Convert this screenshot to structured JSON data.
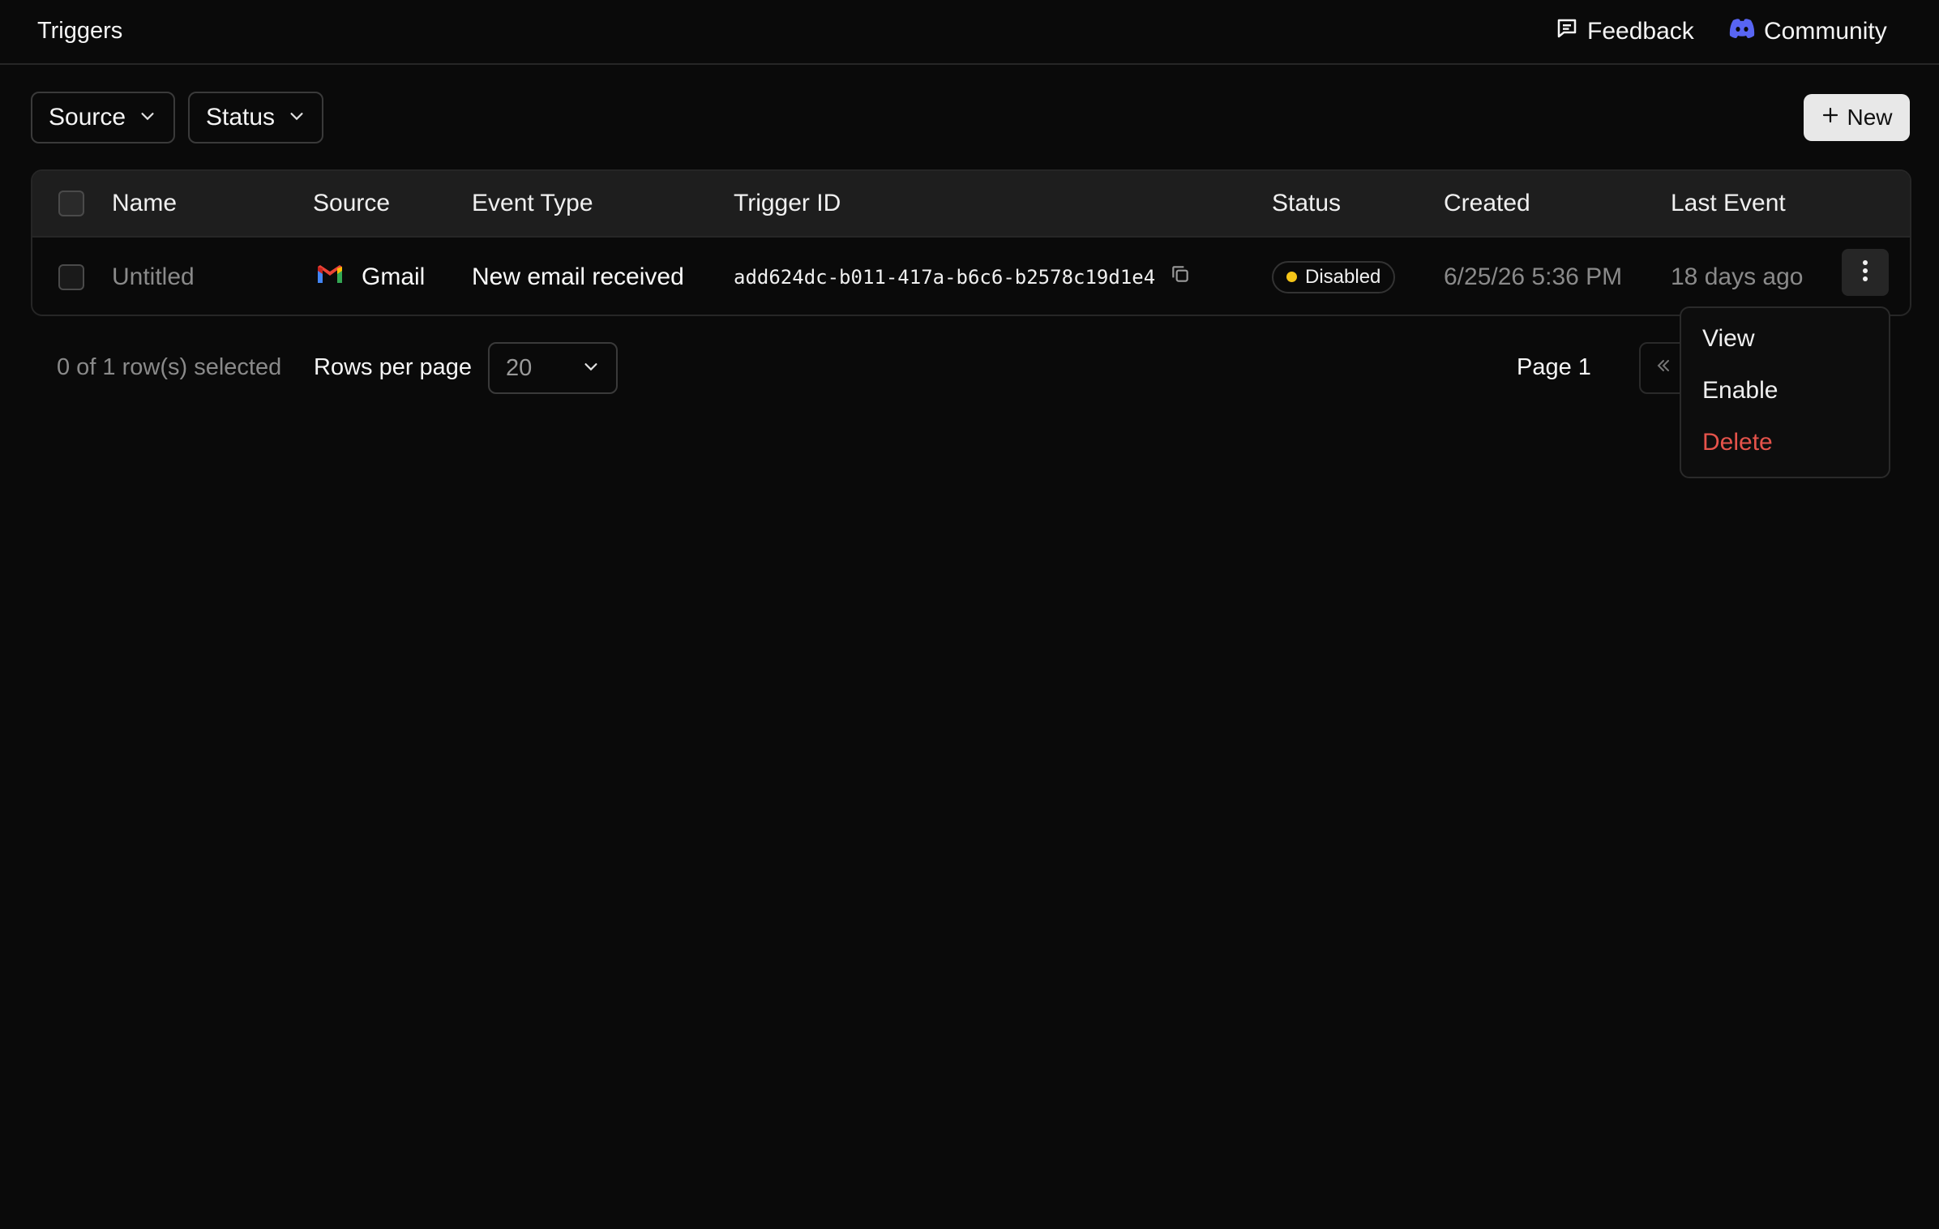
{
  "header": {
    "title": "Triggers",
    "feedback_label": "Feedback",
    "community_label": "Community"
  },
  "toolbar": {
    "filters": [
      {
        "label": "Source"
      },
      {
        "label": "Status"
      }
    ],
    "new_label": "New"
  },
  "table": {
    "columns": [
      "Name",
      "Source",
      "Event Type",
      "Trigger ID",
      "Status",
      "Created",
      "Last Event"
    ],
    "rows": [
      {
        "name": "Untitled",
        "source": "Gmail",
        "event_type": "New email received",
        "trigger_id": "add624dc-b011-417a-b6c6-b2578c19d1e4",
        "status": "Disabled",
        "created": "6/25/26 5:36 PM",
        "last_event": "18 days ago"
      }
    ]
  },
  "footer": {
    "selection_text": "0 of 1 row(s) selected",
    "rows_per_page_label": "Rows per page",
    "rows_per_page_value": "20",
    "page_text": "Page 1"
  },
  "row_menu": {
    "items": [
      {
        "label": "View"
      },
      {
        "label": "Enable"
      },
      {
        "label": "Delete"
      }
    ]
  },
  "colors": {
    "background": "#0a0a0a",
    "status_disabled": "#f5c518",
    "danger": "#e5534b",
    "discord": "#5865f2"
  }
}
